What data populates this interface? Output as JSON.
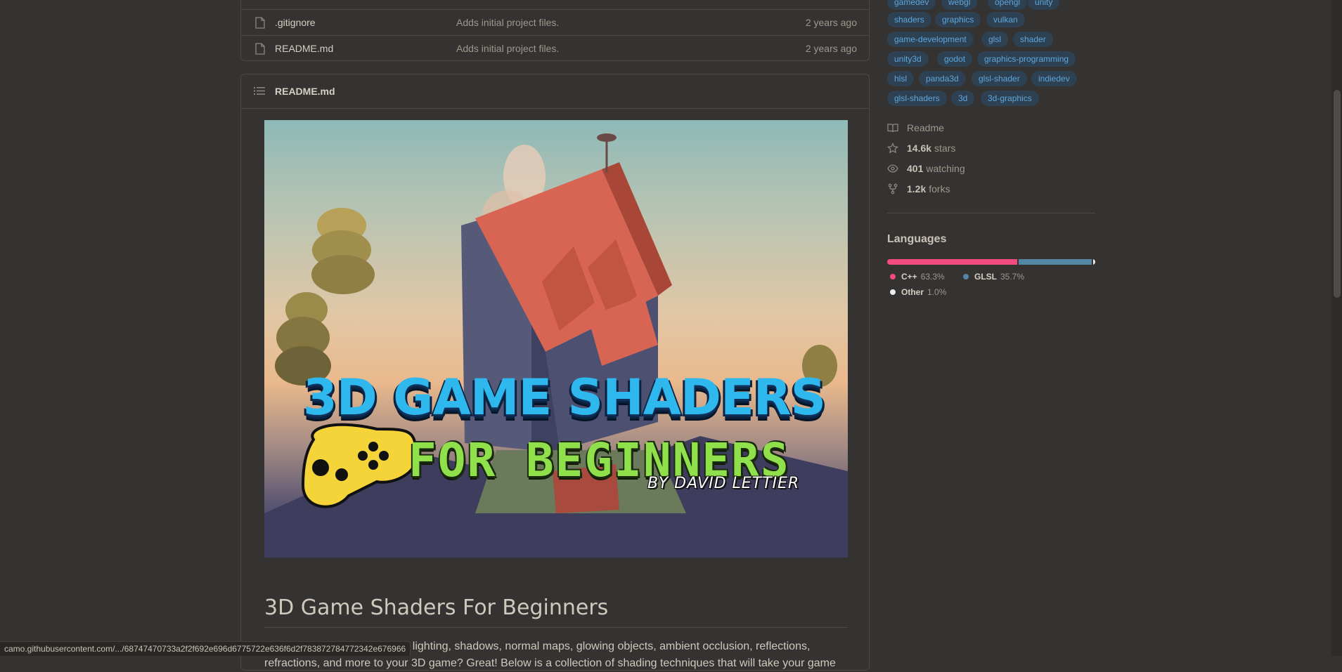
{
  "files": [
    {
      "name": ".gitignore",
      "message": "Adds initial project files.",
      "age": "2 years ago"
    },
    {
      "name": "README.md",
      "message": "Adds initial project files.",
      "age": "2 years ago"
    }
  ],
  "readme": {
    "header_title": "README.md",
    "banner": {
      "line1": "3D GAME SHADERS",
      "line2": "FOR BEGINNERS",
      "line3": "BY DAVID LETTIER"
    },
    "heading": "3D Game Shaders For Beginners",
    "paragraph": "Interested in adding textures, lighting, shadows, normal maps, glowing objects, ambient occlusion, reflections, refractions, and more to your 3D game? Great! Below is a collection of shading techniques that will take your game"
  },
  "topics": [
    "gamedev",
    "webgl",
    "opengl",
    "unity",
    "shaders",
    "graphics",
    "vulkan",
    "game-development",
    "glsl",
    "shader",
    "unity3d",
    "godot",
    "graphics-programming",
    "hlsl",
    "panda3d",
    "glsl-shader",
    "indiedev",
    "glsl-shaders",
    "3d",
    "3d-graphics"
  ],
  "stats": {
    "readme_label": "Readme",
    "stars_value": "14.6k",
    "stars_label": "stars",
    "watching_value": "401",
    "watching_label": "watching",
    "forks_value": "1.2k",
    "forks_label": "forks"
  },
  "languages": {
    "title": "Languages",
    "items": [
      {
        "name": "C++",
        "percent": "63.3%",
        "color": "#f34b7d",
        "fraction": 0.633
      },
      {
        "name": "GLSL",
        "percent": "35.7%",
        "color": "#5686a5",
        "fraction": 0.357
      },
      {
        "name": "Other",
        "percent": "1.0%",
        "color": "#ededed",
        "fraction": 0.01
      }
    ]
  },
  "status_url": "camo.githubusercontent.com/.../68747470733a2f2f692e696d6775722e636f6d2f783872784772342e676966"
}
